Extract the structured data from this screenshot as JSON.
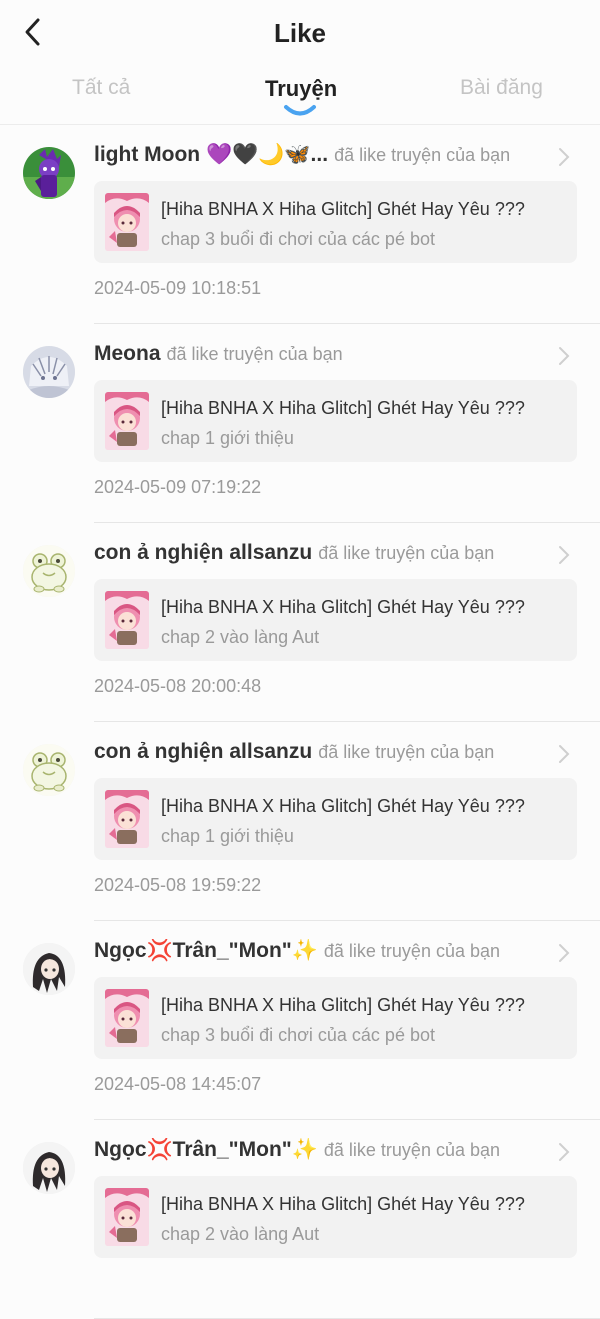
{
  "header": {
    "title": "Like",
    "tabs": [
      "Tất cả",
      "Truyện",
      "Bài đăng"
    ],
    "active_tab": "Truyện",
    "accent_color": "#4aa3f0"
  },
  "notifications": [
    {
      "user": "light Moon 💜🖤🌙🦋...",
      "action": "đã like truyện của bạn",
      "story_title": "[Hiha BNHA X Hiha Glitch] Ghét Hay Yêu ???",
      "chapter": "chap 3 buổi đi chơi của các pé bot",
      "time": "2024-05-09 10:18:51",
      "avatar_icon": "purple-character-avatar"
    },
    {
      "user": "Meona",
      "action": "đã like truyện của bạn",
      "story_title": "[Hiha BNHA X Hiha Glitch] Ghét Hay Yêu ???",
      "chapter": "chap 1 giới thiệu",
      "time": "2024-05-09 07:19:22",
      "avatar_icon": "sketch-character-avatar"
    },
    {
      "user": "con ả nghiện allsanzu",
      "action": "đã like truyện của bạn",
      "story_title": "[Hiha BNHA X Hiha Glitch] Ghét Hay Yêu ???",
      "chapter": "chap 2 vào làng Aut",
      "time": "2024-05-08 20:00:48",
      "avatar_icon": "frog-avatar"
    },
    {
      "user": "con ả nghiện allsanzu",
      "action": "đã like truyện của bạn",
      "story_title": "[Hiha BNHA X Hiha Glitch] Ghét Hay Yêu ???",
      "chapter": "chap 1 giới thiệu",
      "time": "2024-05-08 19:59:22",
      "avatar_icon": "frog-avatar"
    },
    {
      "user": "Ngọc💢Trân_\"Mon\"✨",
      "action": "đã like truyện của bạn",
      "story_title": "[Hiha BNHA X Hiha Glitch] Ghét Hay Yêu ???",
      "chapter": "chap 3 buổi đi chơi của các pé bot",
      "time": "2024-05-08 14:45:07",
      "avatar_icon": "dark-hair-character-avatar"
    },
    {
      "user": "Ngọc💢Trân_\"Mon\"✨",
      "action": "đã like truyện của bạn",
      "story_title": "[Hiha BNHA X Hiha Glitch] Ghét Hay Yêu ???",
      "chapter": "chap 2 vào làng Aut",
      "time": "",
      "avatar_icon": "dark-hair-character-avatar"
    }
  ]
}
